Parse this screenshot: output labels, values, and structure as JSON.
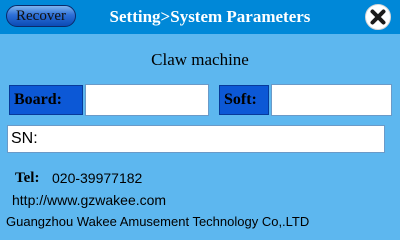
{
  "header": {
    "recover_label": "Recover",
    "title": "Setting>System Parameters",
    "close_icon": "close-circle-x-icon"
  },
  "section_title": "Claw machine",
  "fields": {
    "board_label": "Board:",
    "board_value": "",
    "soft_label": "Soft:",
    "soft_value": "",
    "sn_label": "SN:"
  },
  "footer": {
    "tel_label": "Tel:",
    "tel_number": "020-39977182",
    "url": "http://www.gzwakee.com",
    "company": "Guangzhou Wakee Amusement Technology Co,.LTD"
  },
  "colors": {
    "background": "#5db7ef",
    "header": "#0088d8",
    "label_box": "#0c58d6",
    "field": "#ffffff"
  }
}
